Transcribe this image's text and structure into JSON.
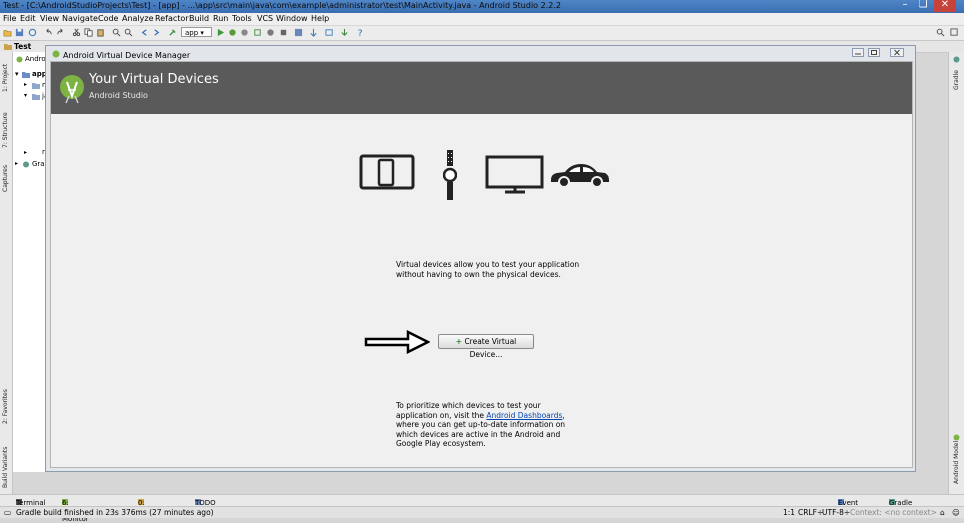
{
  "window": {
    "title": "Test - [C:\\AndroidStudioProjects\\Test] - [app] - ...\\app\\src\\main\\java\\com\\example\\administrator\\test\\MainActivity.java - Android Studio 2.2.2",
    "minimize": "–",
    "maximize": "❏",
    "close": "✕"
  },
  "menu": [
    "File",
    "Edit",
    "View",
    "Navigate",
    "Code",
    "Analyze",
    "Refactor",
    "Build",
    "Run",
    "Tools",
    "VCS",
    "Window",
    "Help"
  ],
  "toolbar": {
    "run_config": "app"
  },
  "navbar": {
    "crumb": "Test"
  },
  "project_panel": {
    "tab": "Android",
    "items": [
      "app",
      "m",
      "ja",
      "r",
      "Gradl"
    ]
  },
  "side_tabs": {
    "left": [
      "1: Project",
      "7: Structure",
      "Captures",
      "2: Favorites",
      "Build Variants"
    ],
    "right": [
      "Gradle",
      "Android Model"
    ]
  },
  "dialog": {
    "title": "Android Virtual Device Manager",
    "heading": "Your Virtual Devices",
    "subheading": "Android Studio",
    "info_text": "Virtual devices allow you to test your application without having to own the physical devices.",
    "create_button": "Create Virtual Device...",
    "prioritize_before": "To prioritize which devices to test your application on, visit the ",
    "prioritize_link": "Android Dashboards",
    "prioritize_after": ", where you can get up-to-date information on which devices are active in the Android and Google Play ecosystem."
  },
  "tool_tabs": {
    "terminal": "Terminal",
    "monitor": "6: Android Monitor",
    "messages": "0: Messages",
    "todo": "TODO",
    "event_log": "Event Log",
    "gradle_console": "Gradle Console"
  },
  "status": {
    "message": "Gradle build finished in 23s 376ms (27 minutes ago)",
    "position": "1:1",
    "line_sep": "CRLF÷",
    "encoding": "UTF-8÷",
    "context": "Context: <no context>"
  },
  "colors": {
    "header_bg": "#5a5a5a",
    "android_green": "#7cb342",
    "link": "#0645ad",
    "titlebar": "#4f86c6"
  }
}
